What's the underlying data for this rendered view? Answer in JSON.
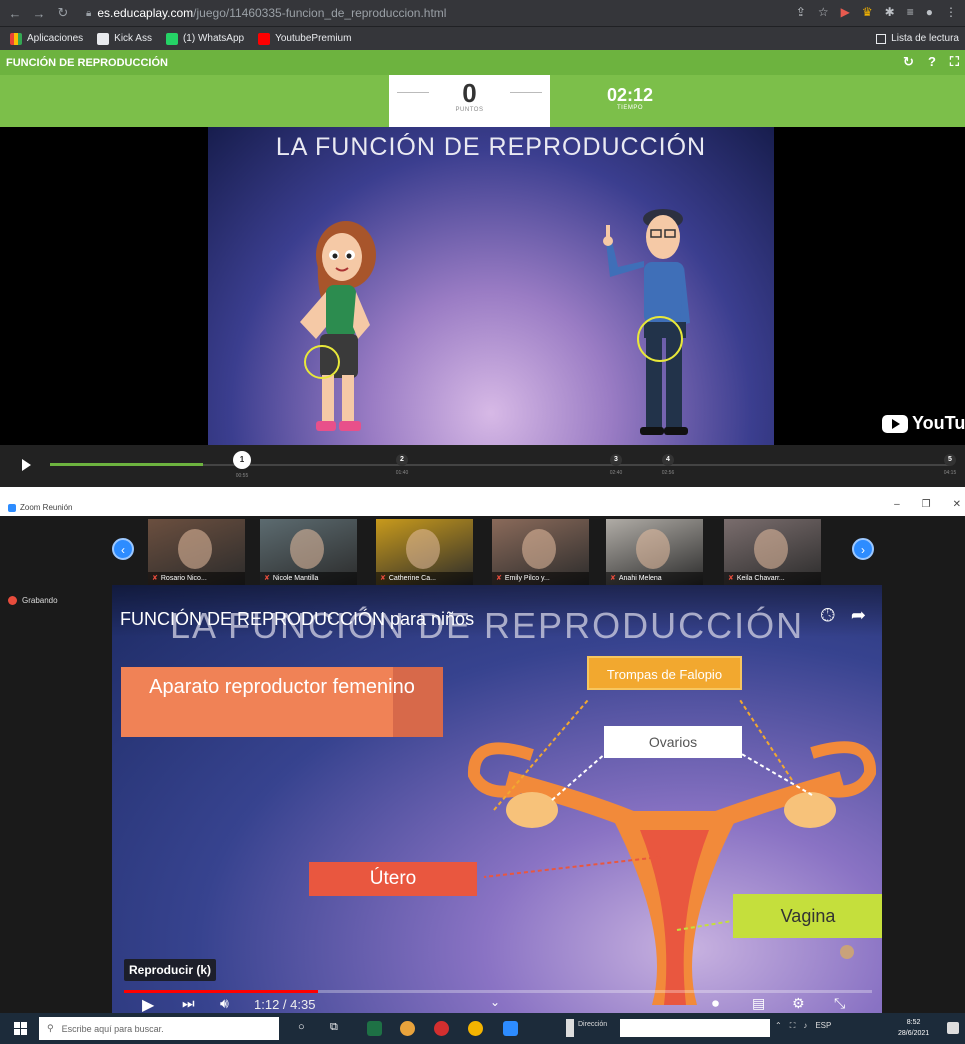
{
  "browser": {
    "url_host": "es.educaplay.com",
    "url_path": "/juego/11460335-funcion_de_reproduccion.html",
    "bookmarks": [
      "Aplicaciones",
      "Kick Ass",
      "(1) WhatsApp",
      "YoutubePremium"
    ],
    "reading_list": "Lista de lectura"
  },
  "game": {
    "header_title": "FUNCIÓN DE REPRODUCCIÓN",
    "score_value": "0",
    "score_label": "PUNTOS",
    "timer_value": "02:12",
    "timer_label": "TIEMPO",
    "slide_title": "LA FUNCIÓN DE REPRODUCCIÓN",
    "youtube_label": "YouTube",
    "progress_fraction": 0.17,
    "markers": [
      {
        "num": "1",
        "time": "00:55",
        "active": true
      },
      {
        "num": "2",
        "time": "01:40",
        "active": false
      },
      {
        "num": "3",
        "time": "02:40",
        "active": false
      },
      {
        "num": "4",
        "time": "02:56",
        "active": false
      },
      {
        "num": "5",
        "time": "04:15",
        "active": false
      }
    ]
  },
  "zoom": {
    "window_title": "Zoom Reunión",
    "recording_label": "Grabando",
    "participants": [
      {
        "name": "Rosario Nico...",
        "color": "#6b4f3f"
      },
      {
        "name": "Nicole Mantilla",
        "color": "#5c6b70"
      },
      {
        "name": "Catherine Ca...",
        "color": "#c89a1c"
      },
      {
        "name": "Emily Pilco y...",
        "color": "#8a6a5a"
      },
      {
        "name": "Anahi Melena",
        "color": "#b0aca6"
      },
      {
        "name": "Keila Chavarr...",
        "color": "#7a6d6d"
      }
    ],
    "video": {
      "youtube_title": "FUNCIÓN DE REPRODUCCIÓN para niños",
      "slide_big_title": "LA FUNCIÓN DE REPRODUCCIÓN",
      "label_aparato": "Aparato reproductor femenino",
      "label_trompas": "Trompas de Falopio",
      "label_ovarios": "Ovarios",
      "label_utero": "Útero",
      "label_vagina": "Vagina",
      "tooltip": "Reproducir (k)",
      "time": "1:12 / 4:35",
      "progress_fraction": 0.26
    }
  },
  "taskbar": {
    "search_placeholder": "Escribe aquí para buscar.",
    "address_label": "Dirección",
    "language": "ESP",
    "clock_time": "8:52",
    "clock_date": "28/6/2021"
  }
}
